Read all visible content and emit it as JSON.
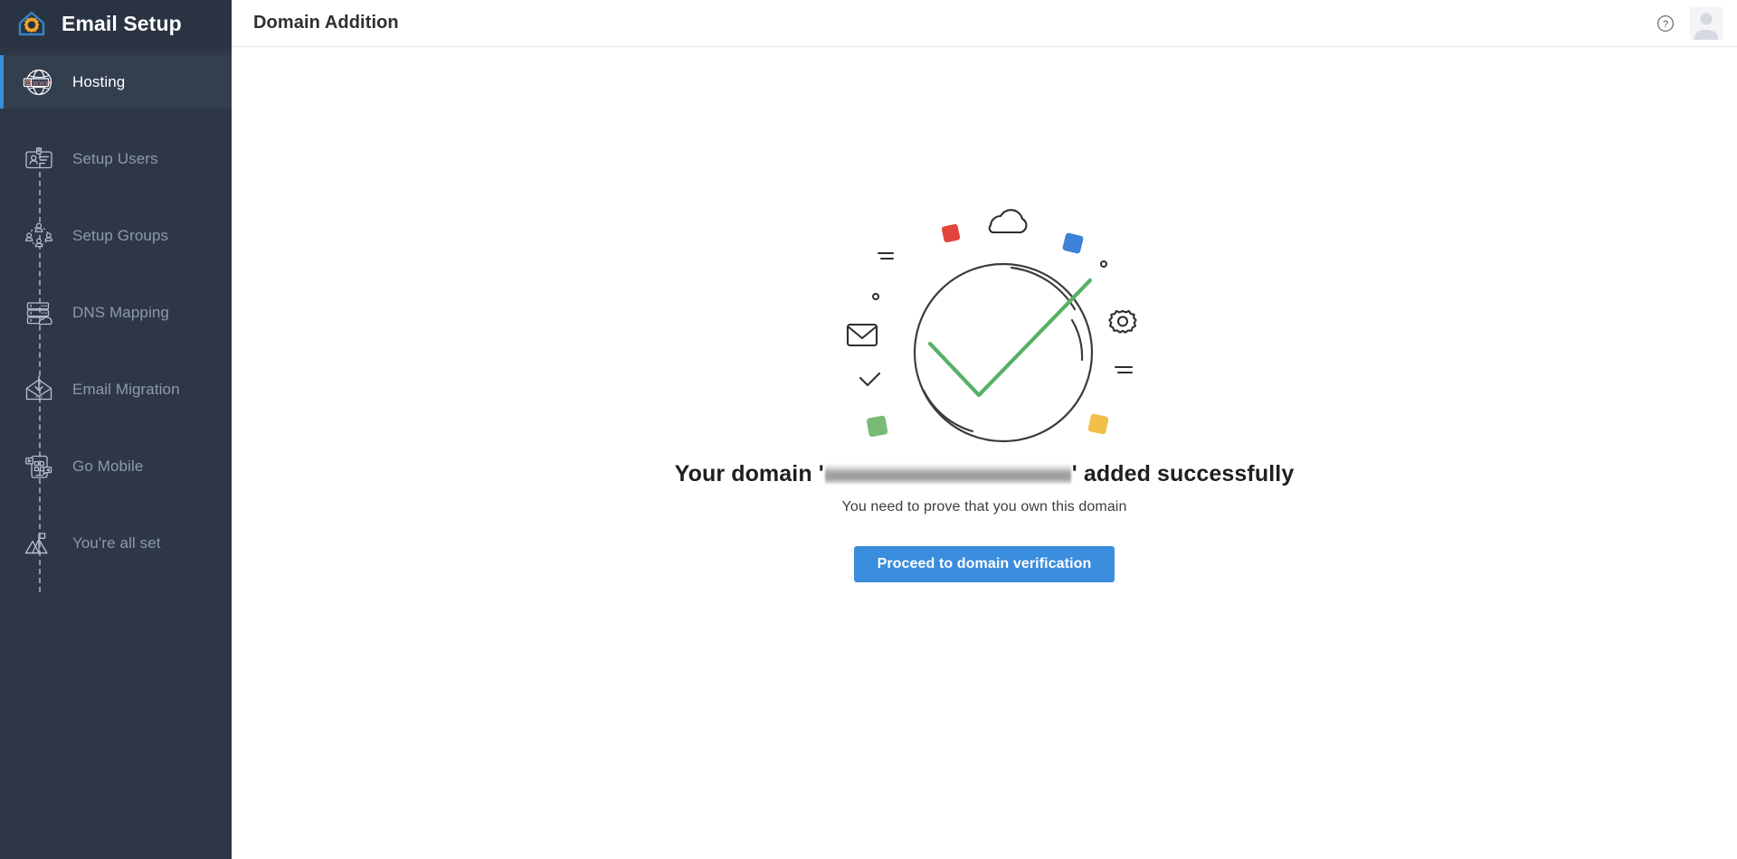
{
  "brand": {
    "title": "Email Setup",
    "logo_icon": "house-gear-icon"
  },
  "sidebar": {
    "items": [
      {
        "label": "Hosting",
        "icon": "globe-www-icon",
        "active": true
      },
      {
        "label": "Setup Users",
        "icon": "id-card-icon",
        "active": false
      },
      {
        "label": "Setup Groups",
        "icon": "user-group-icon",
        "active": false
      },
      {
        "label": "DNS Mapping",
        "icon": "server-cloud-icon",
        "active": false
      },
      {
        "label": "Email Migration",
        "icon": "envelope-arrow-icon",
        "active": false
      },
      {
        "label": "Go Mobile",
        "icon": "mobile-apps-icon",
        "active": false
      },
      {
        "label": "You're all set",
        "icon": "mountain-flag-icon",
        "active": false
      }
    ]
  },
  "topbar": {
    "title": "Domain Addition",
    "help_icon": "question-circle-icon",
    "avatar_icon": "user-avatar-icon"
  },
  "main": {
    "illustration_icon": "domain-verified-checkmark-illustration",
    "headline_prefix": "Your domain '",
    "headline_domain_redacted": "",
    "headline_suffix": "' added successfully",
    "subline": "You need to prove that you own this domain",
    "cta_label": "Proceed to domain verification"
  },
  "colors": {
    "sidebar_bg": "#2d3748",
    "sidebar_active_bg": "#333e4f",
    "accent_blue": "#3c8dde",
    "button_blue": "#3b8ddd",
    "check_green": "#56b265",
    "logo_blue": "#3b82c4",
    "logo_gear_orange": "#f5a623",
    "dot_red": "#e2453c",
    "dot_blue": "#3b82d8",
    "dot_green": "#79bb76",
    "dot_yellow": "#f0c04a",
    "label_grey": "#8e99a8"
  }
}
